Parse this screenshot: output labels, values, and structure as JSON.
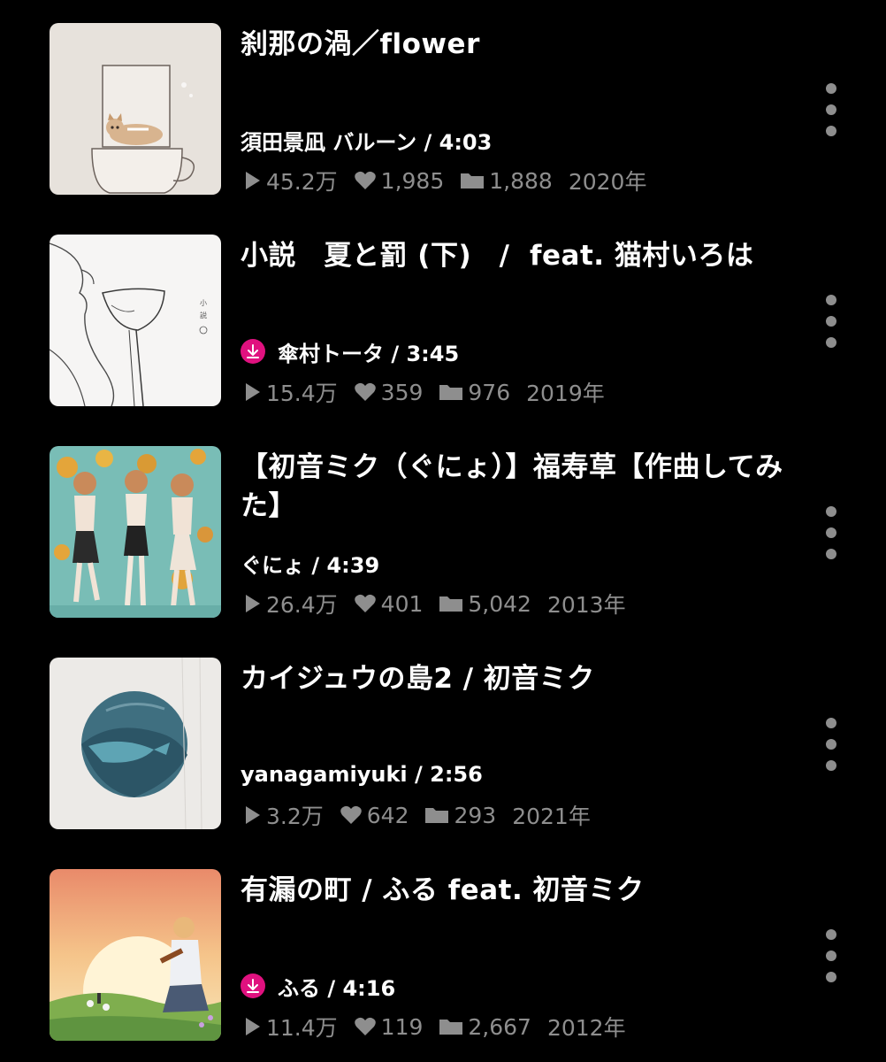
{
  "colors": {
    "background": "#000000",
    "title": "#ffffff",
    "meta": "#8e8e8e",
    "download_badge": "#e0117f"
  },
  "icons": {
    "play": "play-icon",
    "like": "heart-icon",
    "mylist": "folder-icon",
    "download": "download-icon",
    "more": "more-vertical-icon"
  },
  "videos": [
    {
      "title": "刹那の渦／flower",
      "artist": "須田景凪 バルーン / 4:03",
      "downloaded": false,
      "views": "45.2万",
      "likes": "1,985",
      "mylists": "1,888",
      "year": "2020年"
    },
    {
      "title": "小説　夏と罰 (下)　/  feat. 猫村いろは",
      "artist": "傘村トータ / 3:45",
      "downloaded": true,
      "views": "15.4万",
      "likes": "359",
      "mylists": "976",
      "year": "2019年"
    },
    {
      "title": "【初音ミク（ぐにょ）】福寿草【作曲してみた】",
      "artist": "ぐにょ / 4:39",
      "downloaded": false,
      "views": "26.4万",
      "likes": "401",
      "mylists": "5,042",
      "year": "2013年"
    },
    {
      "title": "カイジュウの島2 / 初音ミク",
      "artist": "yanagamiyuki / 2:56",
      "downloaded": false,
      "views": "3.2万",
      "likes": "642",
      "mylists": "293",
      "year": "2021年"
    },
    {
      "title": "有漏の町 / ふる feat. 初音ミク",
      "artist": "ふる / 4:16",
      "downloaded": true,
      "views": "11.4万",
      "likes": "119",
      "mylists": "2,667",
      "year": "2012年"
    }
  ]
}
